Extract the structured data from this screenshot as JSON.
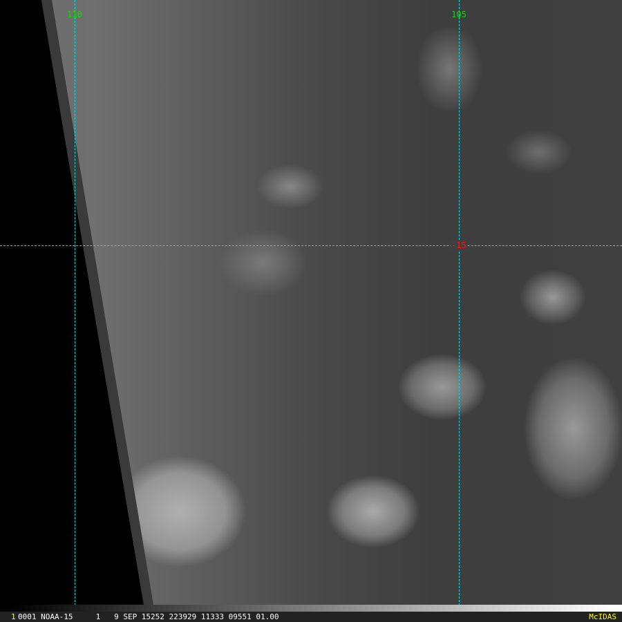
{
  "grid": {
    "longitude_labels": [
      "110",
      "105"
    ],
    "latitude_labels": [
      "-15"
    ],
    "line_color": "#00e5e5",
    "lon_label_color": "#00e000",
    "lat_label_color": "#ff1010"
  },
  "status_bar": {
    "frame": "1",
    "info": "0001 NOAA-15     1   9 SEP 15252 223929 11333 09551 01.00",
    "brand": "McIDAS"
  }
}
